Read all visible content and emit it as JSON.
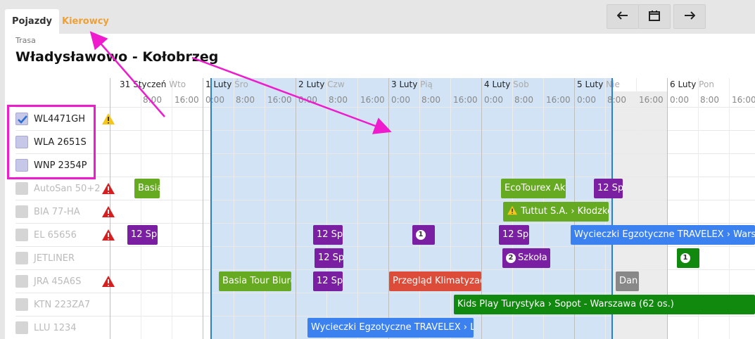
{
  "tabs": {
    "vehicles": "Pojazdy",
    "drivers": "Kierowcy"
  },
  "nav": {
    "prev_icon": "arrow-left-icon",
    "calendar_icon": "calendar-icon",
    "next_icon": "arrow-right-icon"
  },
  "route": {
    "label": "Trasa",
    "title": "Władysławowo - Kołobrzeg"
  },
  "days": [
    {
      "date": "31 Styczeń",
      "dow": "Wto"
    },
    {
      "date": "1 Luty",
      "dow": "Śro"
    },
    {
      "date": "2 Luty",
      "dow": "Czw"
    },
    {
      "date": "3 Luty",
      "dow": "Pią"
    },
    {
      "date": "4 Luty",
      "dow": "Sob"
    },
    {
      "date": "5 Luty",
      "dow": "Nie"
    },
    {
      "date": "6 Luty",
      "dow": "Pon"
    }
  ],
  "hours": [
    "0:00",
    "8:00",
    "16:00"
  ],
  "vehicles": [
    {
      "name": "WL4471GH",
      "selected": true,
      "warning": "warning-yellow"
    },
    {
      "name": "WLA 2651S",
      "selected": true,
      "warning": null
    },
    {
      "name": "WNP 2354P",
      "selected": true,
      "warning": null
    },
    {
      "name": "AutoSan 50+2",
      "selected": false,
      "warning": "warning-red"
    },
    {
      "name": "BIA 77-HA",
      "selected": false,
      "warning": "warning-red"
    },
    {
      "name": "EL 65656",
      "selected": false,
      "warning": "warning-red"
    },
    {
      "name": "JETLINER",
      "selected": false,
      "warning": null
    },
    {
      "name": "JRA 45A6S",
      "selected": false,
      "warning": "warning-red"
    },
    {
      "name": "KTN 223ZA7",
      "selected": false,
      "warning": null
    },
    {
      "name": "LLU 1234",
      "selected": false,
      "warning": null
    }
  ],
  "events": [
    {
      "text": "Basia",
      "color": "#66aa22"
    },
    {
      "text": "EcoTourex Akt",
      "color": "#66aa22"
    },
    {
      "text": "12 Sp",
      "color": "#7a1fa2"
    },
    {
      "text": "Tuttut S.A. › Kłodzko",
      "color": "#66aa22",
      "warn": true
    },
    {
      "text": "12 Sp",
      "color": "#7a1fa2"
    },
    {
      "text": "12 Sp",
      "color": "#7a1fa2"
    },
    {
      "text": "",
      "color": "#7a1fa2",
      "badge": "1"
    },
    {
      "text": "12 Sp",
      "color": "#7a1fa2"
    },
    {
      "text": "Wycieczki Egzotyczne TRAVELEX › Warszaw",
      "color": "#3b82f0"
    },
    {
      "text": "12 Sp",
      "color": "#7a1fa2"
    },
    {
      "text": "Szkoła",
      "color": "#7a1fa2",
      "badge": "2"
    },
    {
      "text": "",
      "color": "#11880e",
      "badge": "1"
    },
    {
      "text": "Basia Tour Biuro",
      "color": "#66aa22"
    },
    {
      "text": "12 Sp",
      "color": "#7a1fa2"
    },
    {
      "text": "Przegląd Klimatyzacj",
      "color": "#dd4b39"
    },
    {
      "text": "Dan",
      "color": "#888888"
    },
    {
      "text": "Kids Play Turystyka › Sopot - Warszawa (62 os.)",
      "color": "#11880e"
    },
    {
      "text": "Wycieczki Egzotyczne TRAVELEX › Lasy",
      "color": "#3b82f0"
    }
  ]
}
